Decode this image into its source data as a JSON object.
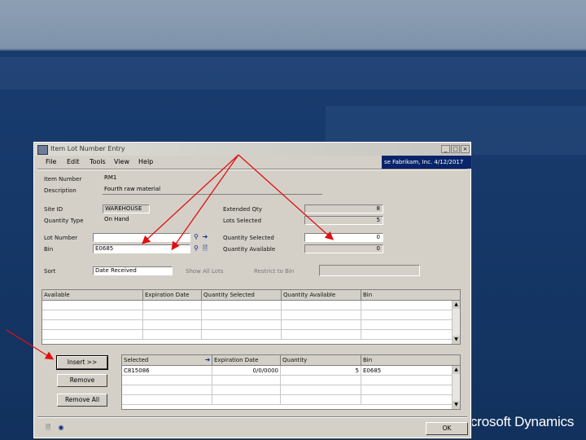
{
  "window": {
    "title": "Item Lot Number Entry",
    "company": "se Fabrikam, Inc. 4/12/2017",
    "controls": [
      "_",
      "□",
      "×"
    ]
  },
  "menu": [
    "File",
    "Edit",
    "Tools",
    "View",
    "Help"
  ],
  "header": {
    "item_number_label": "Item Number",
    "item_number": "RM1",
    "description_label": "Description",
    "description": "Fourth raw material",
    "site_id_label": "Site ID",
    "site_id": "WAREHOUSE",
    "quantity_type_label": "Quantity Type",
    "quantity_type": "On Hand",
    "extended_qty_label": "Extended Qty",
    "extended_qty": "8",
    "lots_selected_label": "Lots Selected",
    "lots_selected": "5",
    "lot_number_label": "Lot Number",
    "lot_number": "",
    "bin_label": "Bin",
    "bin": "E0685",
    "quantity_selected_label": "Quantity Selected",
    "quantity_selected": "0",
    "quantity_available_label": "Quantity Available",
    "quantity_available": "0",
    "sort_label": "Sort",
    "sort_value": "Date Received",
    "show_all_lots": "Show All Lots",
    "restrict_to_bin": "Restrict to Bin"
  },
  "available_grid": {
    "columns": [
      "Available",
      "Expiration Date",
      "Quantity Selected",
      "Quantity Available",
      "Bin"
    ],
    "rows": [
      [
        "",
        "",
        "",
        "",
        ""
      ],
      [
        "",
        "",
        "",
        "",
        ""
      ],
      [
        "",
        "",
        "",
        "",
        ""
      ],
      [
        "",
        "",
        "",
        "",
        ""
      ]
    ]
  },
  "buttons": {
    "insert": "Insert >>",
    "remove": "Remove",
    "remove_all": "Remove All",
    "ok": "OK"
  },
  "selected_grid": {
    "columns": [
      "Selected",
      "Expiration Date",
      "Quantity",
      "Bin"
    ],
    "rows": [
      [
        "C815086",
        "0/0/0000",
        "5",
        "E0685"
      ],
      [
        "",
        "",
        "",
        ""
      ],
      [
        "",
        "",
        "",
        ""
      ],
      [
        "",
        "",
        "",
        ""
      ]
    ]
  },
  "brand": "crosoft Dynamics",
  "colors": {
    "background": "#16396a",
    "window": "#d4d0c8",
    "company_bar": "#0a246a",
    "annotation_arrow": "#e01010"
  },
  "icons": [
    "window-icon",
    "lookup-icon",
    "expand-arrow-icon",
    "note-icon",
    "help-icon",
    "sort-arrow-icon"
  ]
}
